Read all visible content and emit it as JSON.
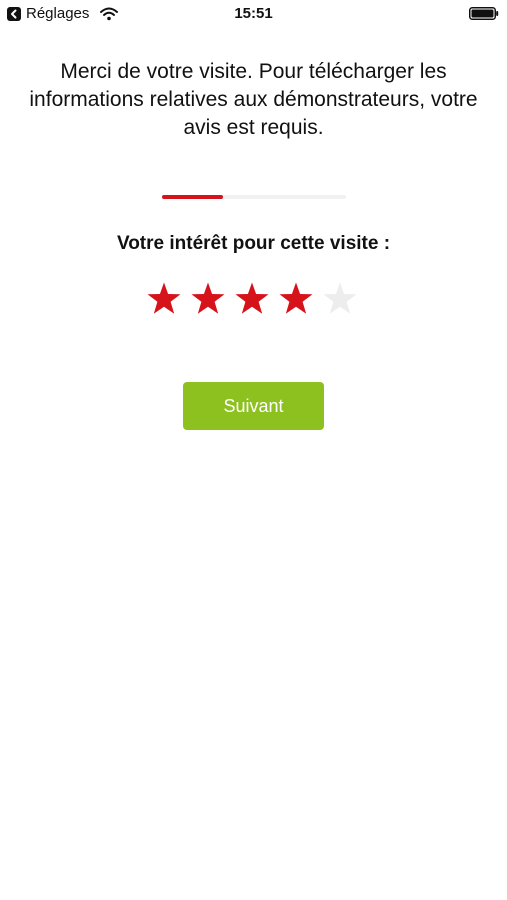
{
  "status_bar": {
    "back_app_label": "Réglages",
    "time": "15:51",
    "battery_level": 1.0
  },
  "intro": {
    "text": "Merci de votre visite. Pour télécharger les informations relatives aux démonstrateurs, votre avis est requis."
  },
  "progress": {
    "value": 0.33
  },
  "rating": {
    "question": "Votre intérêt pour cette visite :",
    "max": 5,
    "value": 4
  },
  "actions": {
    "next_label": "Suivant"
  },
  "colors": {
    "accent_red": "#d6131b",
    "star_empty": "#ededed",
    "button_green": "#8cc11f",
    "progress_track": "#f1f1f1"
  },
  "icons": {
    "back": "chevron-left-icon",
    "wifi": "wifi-icon",
    "battery": "battery-icon",
    "star": "star-icon"
  }
}
